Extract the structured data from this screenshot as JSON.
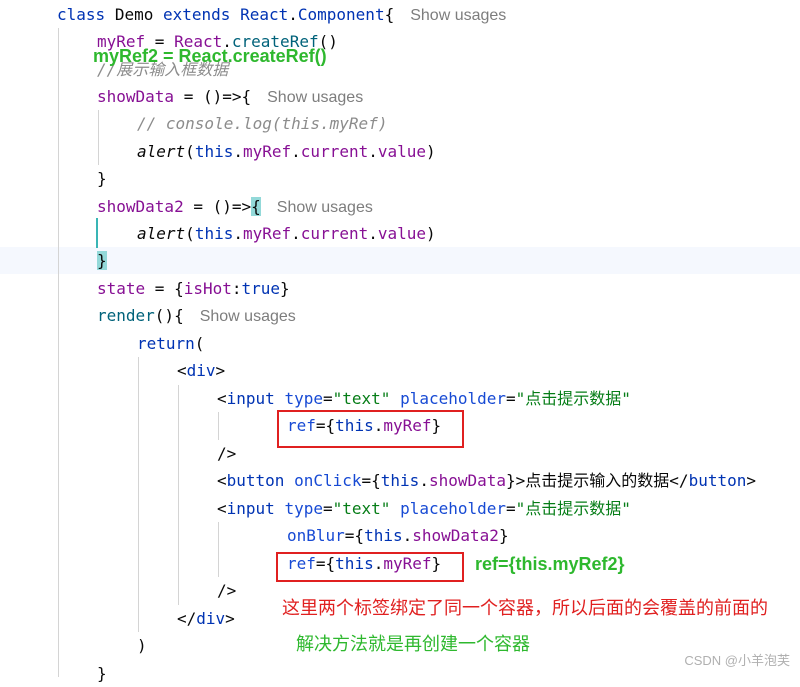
{
  "code": {
    "l1": {
      "kw_class": "class",
      "name": "Demo",
      "kw_extends": "extends",
      "base_obj": "React",
      "dot": ".",
      "base_cls": "Component",
      "brace": "{",
      "hint": "Show usages"
    },
    "l2": {
      "field": "myRef",
      "eq": " = ",
      "obj": "React",
      "dot": ".",
      "fn": "createRef",
      "parens": "()"
    },
    "l3": {
      "comment": "//展示输入框数据"
    },
    "l4": {
      "field": "showData",
      "rest": " = ()=>{",
      "hint": "Show usages"
    },
    "l5": {
      "comment": "// console.log(this.myRef)"
    },
    "l6": {
      "fn": "alert",
      "open": "(",
      "kw_this": "this",
      "dot1": ".",
      "f1": "myRef",
      "dot2": ".",
      "f2": "current",
      "dot3": ".",
      "f3": "value",
      "close": ")"
    },
    "l7": {
      "text": "}"
    },
    "l8": {
      "field": "showData2",
      "rest": " = ()=>",
      "brace": "{",
      "hint": "Show usages"
    },
    "l9": {
      "fn": "alert",
      "open": "(",
      "kw_this": "this",
      "dot1": ".",
      "f1": "myRef",
      "dot2": ".",
      "f2": "current",
      "dot3": ".",
      "f3": "value",
      "close": ")"
    },
    "l10": {
      "text": "}"
    },
    "l11": {
      "field": "state",
      "eq": " = {",
      "key": "isHot",
      "colon": ":",
      "kw_true": "true",
      "close": "}"
    },
    "l12": {
      "fn": "render",
      "rest": "(){",
      "hint": "Show usages"
    },
    "l13": {
      "kw_return": "return",
      "open": "("
    },
    "l14": {
      "lt": "<",
      "tag": "div",
      "gt": ">"
    },
    "l15": {
      "lt": "<",
      "tag": "input",
      "attr_type": "type",
      "eq1": "=",
      "val_type": "\"text\"",
      "attr_ph": "placeholder",
      "eq2": "=",
      "val_ph": "\"点击提示数据\""
    },
    "l16": {
      "attr": "ref",
      "eq": "={",
      "kw_this": "this",
      "dot": ".",
      "field": "myRef",
      "close": "}"
    },
    "l17": {
      "text": "/>"
    },
    "l18": {
      "lt": "<",
      "tag": "button",
      "attr": "onClick",
      "eq": "={",
      "kw_this": "this",
      "dot": ".",
      "field": "showData",
      "close": "}>",
      "label": "点击提示输入的数据",
      "end_lt": "</",
      "end_tag": "button",
      "end_gt": ">"
    },
    "l19": {
      "lt": "<",
      "tag": "input",
      "attr_type": "type",
      "eq1": "=",
      "val_type": "\"text\"",
      "attr_ph": "placeholder",
      "eq2": "=",
      "val_ph": "\"点击提示数据\""
    },
    "l20": {
      "attr": "onBlur",
      "eq": "={",
      "kw_this": "this",
      "dot": ".",
      "field": "showData2",
      "close": "}"
    },
    "l21": {
      "attr": "ref",
      "eq": "={",
      "kw_this": "this",
      "dot": ".",
      "field": "myRef",
      "close": "}"
    },
    "l22": {
      "text": "/>"
    },
    "l23": {
      "lt": "</",
      "tag": "div",
      "gt": ">"
    },
    "l24": {
      "text": ")"
    },
    "l25": {
      "text": "}"
    }
  },
  "annotations": {
    "top_fix": "myRef2 = React.createRef()",
    "ref_fix": "ref={this.myRef2}",
    "explain": "这里两个标签绑定了同一个容器，所以后面的会覆盖的前面的",
    "solution": "解决方法就是再创建一个容器"
  },
  "watermark": "CSDN @小羊泡芙",
  "colors": {
    "keyword": "#0033b3",
    "field": "#871094",
    "function": "#00627a",
    "string": "#067d17",
    "comment": "#8c8c8c",
    "annotation_green": "#2eb82e",
    "annotation_red": "#e02020"
  }
}
